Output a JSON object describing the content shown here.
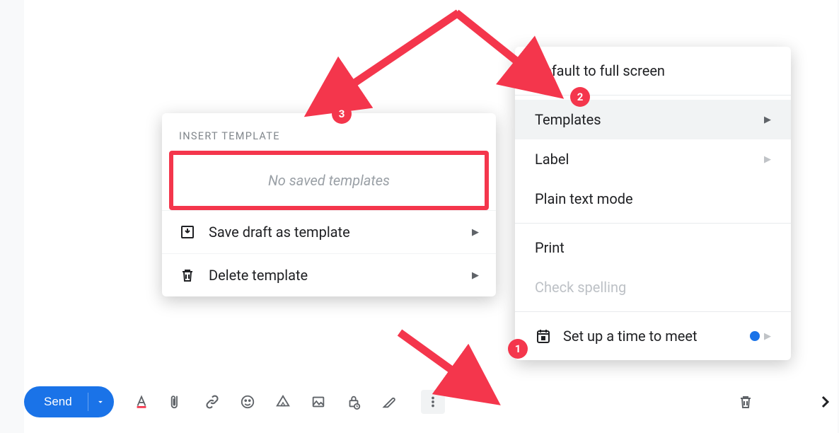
{
  "toolbar": {
    "send_label": "Send"
  },
  "options_menu": {
    "default_full_screen": "Default to full screen",
    "templates": "Templates",
    "label": "Label",
    "plain_text": "Plain text mode",
    "print": "Print",
    "check_spelling": "Check spelling",
    "set_up_meet": "Set up a time to meet"
  },
  "template_menu": {
    "header": "INSERT TEMPLATE",
    "empty_text": "No saved templates",
    "save_draft": "Save draft as template",
    "delete_template": "Delete template"
  },
  "annotations": {
    "badge1": "1",
    "badge2": "2",
    "badge3": "3"
  },
  "colors": {
    "accent": "#1a73e8",
    "annotation": "#f4364c"
  }
}
